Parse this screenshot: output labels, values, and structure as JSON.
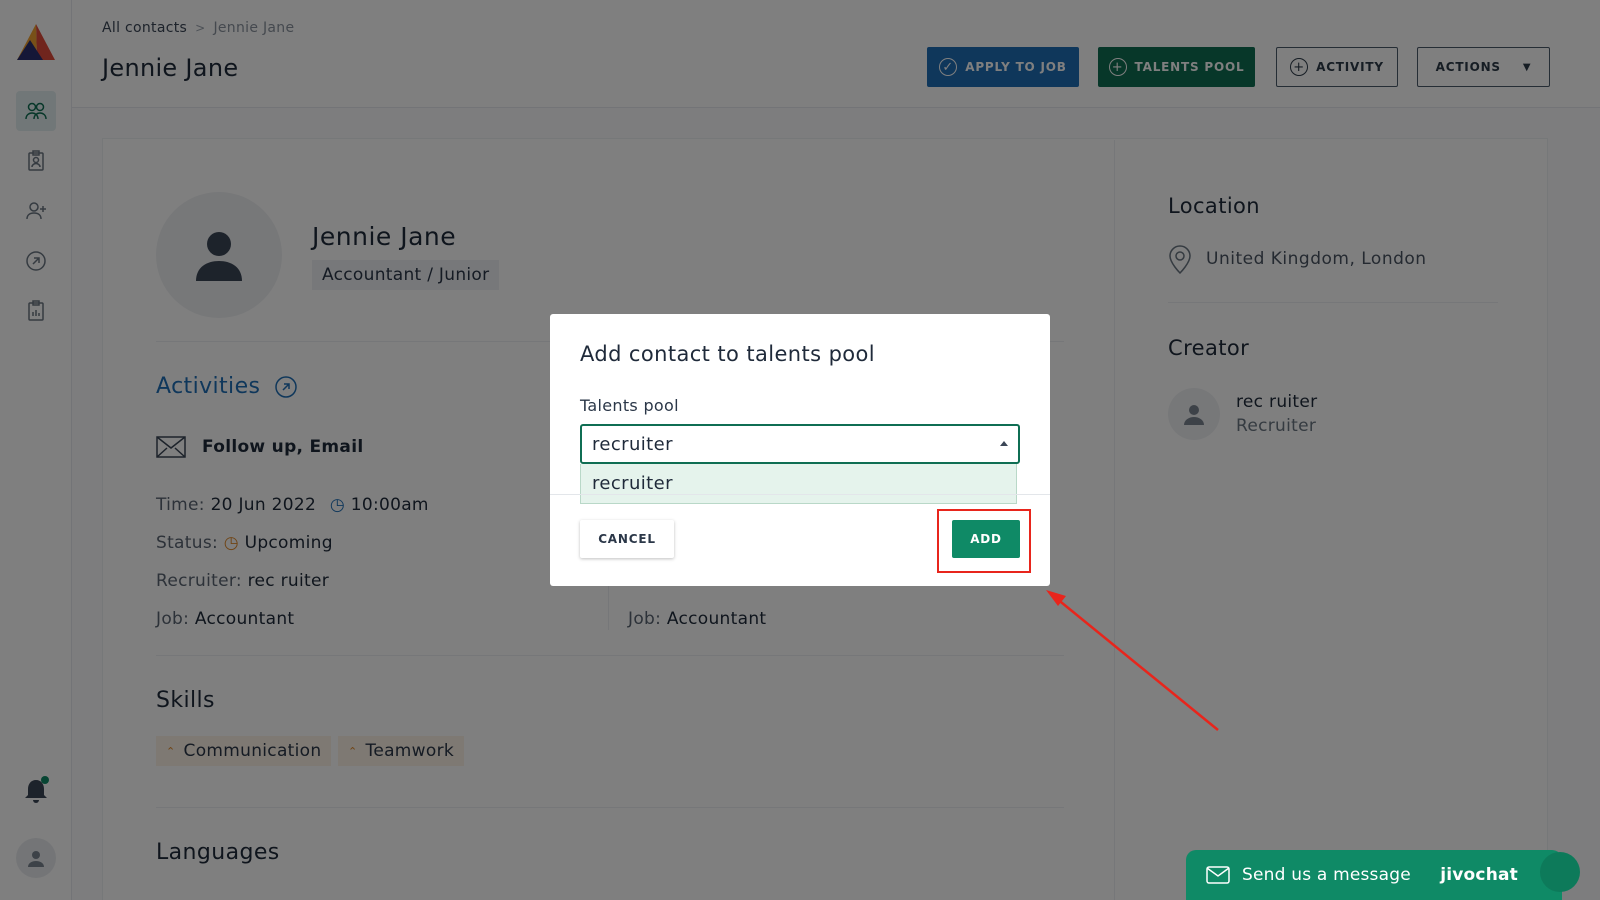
{
  "breadcrumb": {
    "root": "All contacts",
    "separator": ">",
    "current": "Jennie Jane"
  },
  "page": {
    "title": "Jennie Jane"
  },
  "header_buttons": {
    "apply": "APPLY TO JOB",
    "talents": "TALENTS POOL",
    "activity": "ACTIVITY",
    "actions": "ACTIONS"
  },
  "profile": {
    "name": "Jennie Jane",
    "role": "Accountant / Junior"
  },
  "activities": {
    "title": "Activities",
    "item_title": "Follow up, Email",
    "time_label": "Time:",
    "date": "20 Jun 2022",
    "time": "10:00am",
    "status_label": "Status:",
    "status": "Upcoming",
    "recruiter_label": "Recruiter:",
    "recruiter": "rec ruiter",
    "job_label": "Job:",
    "job": "Accountant",
    "job2": "Accountant",
    "recruiter2_partial": "Recruiter: rec ruiter"
  },
  "skills": {
    "title": "Skills",
    "items": [
      "Communication",
      "Teamwork"
    ]
  },
  "languages": {
    "title": "Languages"
  },
  "location": {
    "title": "Location",
    "value": "United Kingdom, London"
  },
  "creator": {
    "title": "Creator",
    "name": "rec ruiter",
    "role": "Recruiter"
  },
  "modal": {
    "title": "Add contact to talents pool",
    "field_label": "Talents pool",
    "selected": "recruiter",
    "option": "recruiter",
    "cancel": "CANCEL",
    "add": "ADD"
  },
  "chat": {
    "message": "Send us a message",
    "brand": "jivochat"
  },
  "colors": {
    "primary_blue": "#1f6fb7",
    "primary_green": "#0f6e53",
    "add_green": "#0f8a66",
    "highlight_red": "#e8251c"
  }
}
